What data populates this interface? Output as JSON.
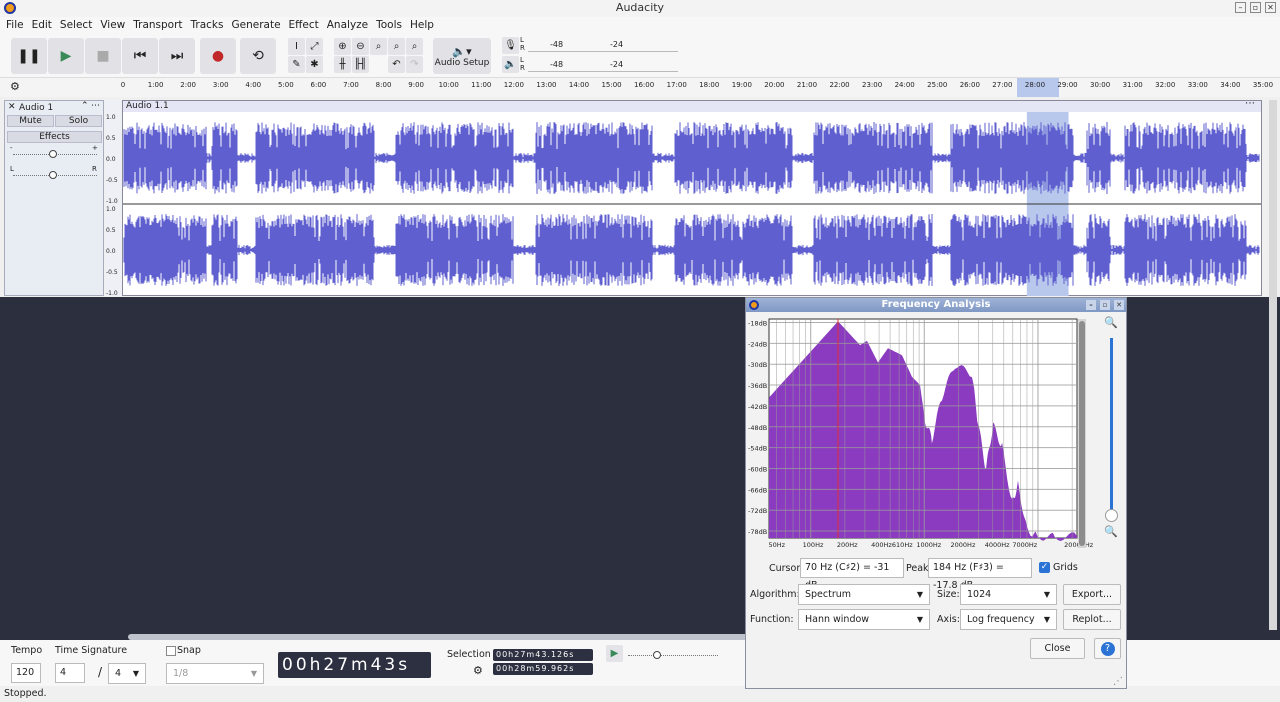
{
  "window": {
    "title": "Audacity"
  },
  "menu": [
    "File",
    "Edit",
    "Select",
    "View",
    "Transport",
    "Tracks",
    "Generate",
    "Effect",
    "Analyze",
    "Tools",
    "Help"
  ],
  "toolbar": {
    "audio_setup": "Audio Setup",
    "meter_labels": [
      "-48",
      "-24"
    ],
    "lr": [
      "L",
      "R"
    ]
  },
  "ruler": {
    "ticks": [
      "0",
      "1:00",
      "2:00",
      "3:00",
      "4:00",
      "5:00",
      "6:00",
      "7:00",
      "8:00",
      "9:00",
      "10:00",
      "11:00",
      "12:00",
      "13:00",
      "14:00",
      "15:00",
      "16:00",
      "17:00",
      "18:00",
      "19:00",
      "20:00",
      "21:00",
      "22:00",
      "23:00",
      "24:00",
      "25:00",
      "26:00",
      "27:00",
      "28:00",
      "29:00",
      "30:00",
      "31:00",
      "32:00",
      "33:00",
      "34:00",
      "35:00"
    ]
  },
  "track": {
    "name": "Audio 1",
    "clip": "Audio 1.1",
    "mute": "Mute",
    "solo": "Solo",
    "effects": "Effects",
    "gain_minus": "-",
    "gain_plus": "+",
    "pan_l": "L",
    "pan_r": "R",
    "scale": [
      "1.0",
      "0.5",
      "0.0",
      "-0.5",
      "-1.0"
    ],
    "selection_start_min": 27.72,
    "selection_end_min": 29.0
  },
  "dialog": {
    "title": "Frequency Analysis",
    "cursor_label": "Cursor:",
    "cursor_value": "70 Hz (C♯2) = -31 dB",
    "peak_label": "Peak:",
    "peak_value": "184 Hz (F♯3) = -17.8 dB",
    "grids_label": "Grids",
    "grids_checked": true,
    "algorithm_label": "Algorithm:",
    "algorithm": "Spectrum",
    "size_label": "Size:",
    "size": "1024",
    "function_label": "Function:",
    "function": "Hann window",
    "axis_label": "Axis:",
    "axis": "Log frequency",
    "export": "Export...",
    "replot": "Replot...",
    "close": "Close",
    "help": "?",
    "db_labels": [
      "-18dB",
      "-24dB",
      "-30dB",
      "-36dB",
      "-42dB",
      "-48dB",
      "-54dB",
      "-60dB",
      "-66dB",
      "-72dB",
      "-78dB"
    ],
    "freq_labels": [
      "50Hz",
      "100Hz",
      "200Hz",
      "400Hz",
      "610Hz",
      "1000Hz",
      "2000Hz",
      "4000Hz",
      "7000Hz",
      "20000Hz"
    ],
    "spectrum": {
      "freq_hz": [
        43,
        174,
        272,
        313,
        391,
        479,
        635,
        778,
        916,
        1013,
        1167,
        1429,
        1862,
        2624,
        2965,
        3489,
        4018,
        4831,
        5906,
        6668,
        8000,
        9795,
        14125,
        22050
      ],
      "db": [
        -39.6,
        -17.7,
        -24.5,
        -23.3,
        -29.5,
        -25.4,
        -27.4,
        -33.6,
        -36,
        -46,
        -51.7,
        -39.3,
        -30.3,
        -33,
        -47,
        -60.4,
        -47.5,
        -53.7,
        -69.9,
        -64.6,
        -77.5,
        -79.5,
        -79.7,
        -79.5
      ],
      "cursor_hz": 174,
      "color": "#8a3bbf"
    }
  },
  "bottom": {
    "tempo_label": "Tempo",
    "tempo": "120",
    "timesig_label": "Time Signature",
    "timesig_num": "4",
    "timesig_den": "4",
    "snap_label": "Snap",
    "snap_value": "1/8",
    "time": "00h27m43s",
    "selection_label": "Selection",
    "sel_start": "00h27m43.126s",
    "sel_end": "00h28m59.962s"
  },
  "status": "Stopped.",
  "colors": {
    "wave": "#5f5fd0",
    "selection": "#b8c8ec"
  }
}
